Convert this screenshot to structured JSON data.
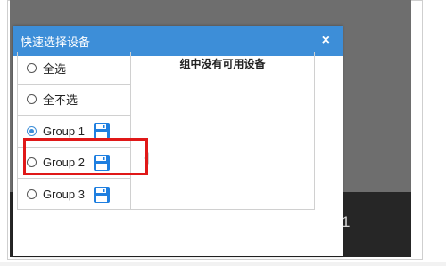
{
  "dialog": {
    "title": "快速选择设备",
    "close_label": "×",
    "empty_message": "组中没有可用设备"
  },
  "list": {
    "items": [
      {
        "label": "全选",
        "selected": false,
        "has_save_icon": false
      },
      {
        "label": "全不选",
        "selected": false,
        "has_save_icon": false
      },
      {
        "label": "Group 1",
        "selected": true,
        "has_save_icon": true
      },
      {
        "label": "Group 2",
        "selected": false,
        "has_save_icon": true
      },
      {
        "label": "Group 3",
        "selected": false,
        "has_save_icon": true
      }
    ]
  },
  "backdrop": {
    "text": "1"
  },
  "colors": {
    "header": "#3d8ed8",
    "highlight": "#e01818",
    "save_icon": "#1f7fe0"
  },
  "icons": {
    "save": "floppy-disk-icon",
    "close": "close-icon"
  }
}
